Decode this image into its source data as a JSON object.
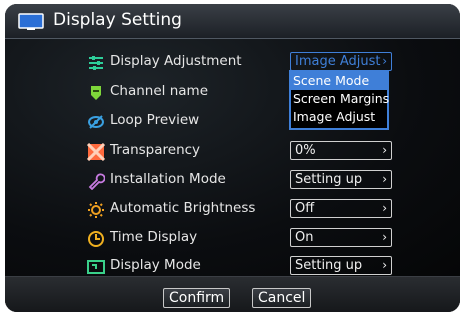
{
  "window": {
    "title": "Display Setting",
    "icon": "monitor-icon"
  },
  "rows": [
    {
      "label": "Display Adjustment",
      "icon": "sliders-icon",
      "value": "Image Adjust",
      "active": true
    },
    {
      "label": "Channel name",
      "icon": "badge-icon",
      "value": ""
    },
    {
      "label": "Loop Preview",
      "icon": "loop-icon",
      "value": ""
    },
    {
      "label": "Transparency",
      "icon": "transparency-icon",
      "value": "0%"
    },
    {
      "label": "Installation Mode",
      "icon": "wrench-icon",
      "value": "Setting up"
    },
    {
      "label": "Automatic Brightness",
      "icon": "brightness-icon",
      "value": "Off"
    },
    {
      "label": "Time Display",
      "icon": "clock-icon",
      "value": "On"
    },
    {
      "label": "Display Mode",
      "icon": "display-mode-icon",
      "value": "Setting up"
    }
  ],
  "dropdown": {
    "options": [
      "Scene Mode",
      "Screen Margins",
      "Image Adjust"
    ],
    "highlighted": "Scene Mode"
  },
  "footer": {
    "confirm_label": "Confirm",
    "cancel_label": "Cancel"
  },
  "colors": {
    "accent": "#3f7fd8",
    "title_bar": "#2a2f36",
    "background": "#07090c"
  }
}
